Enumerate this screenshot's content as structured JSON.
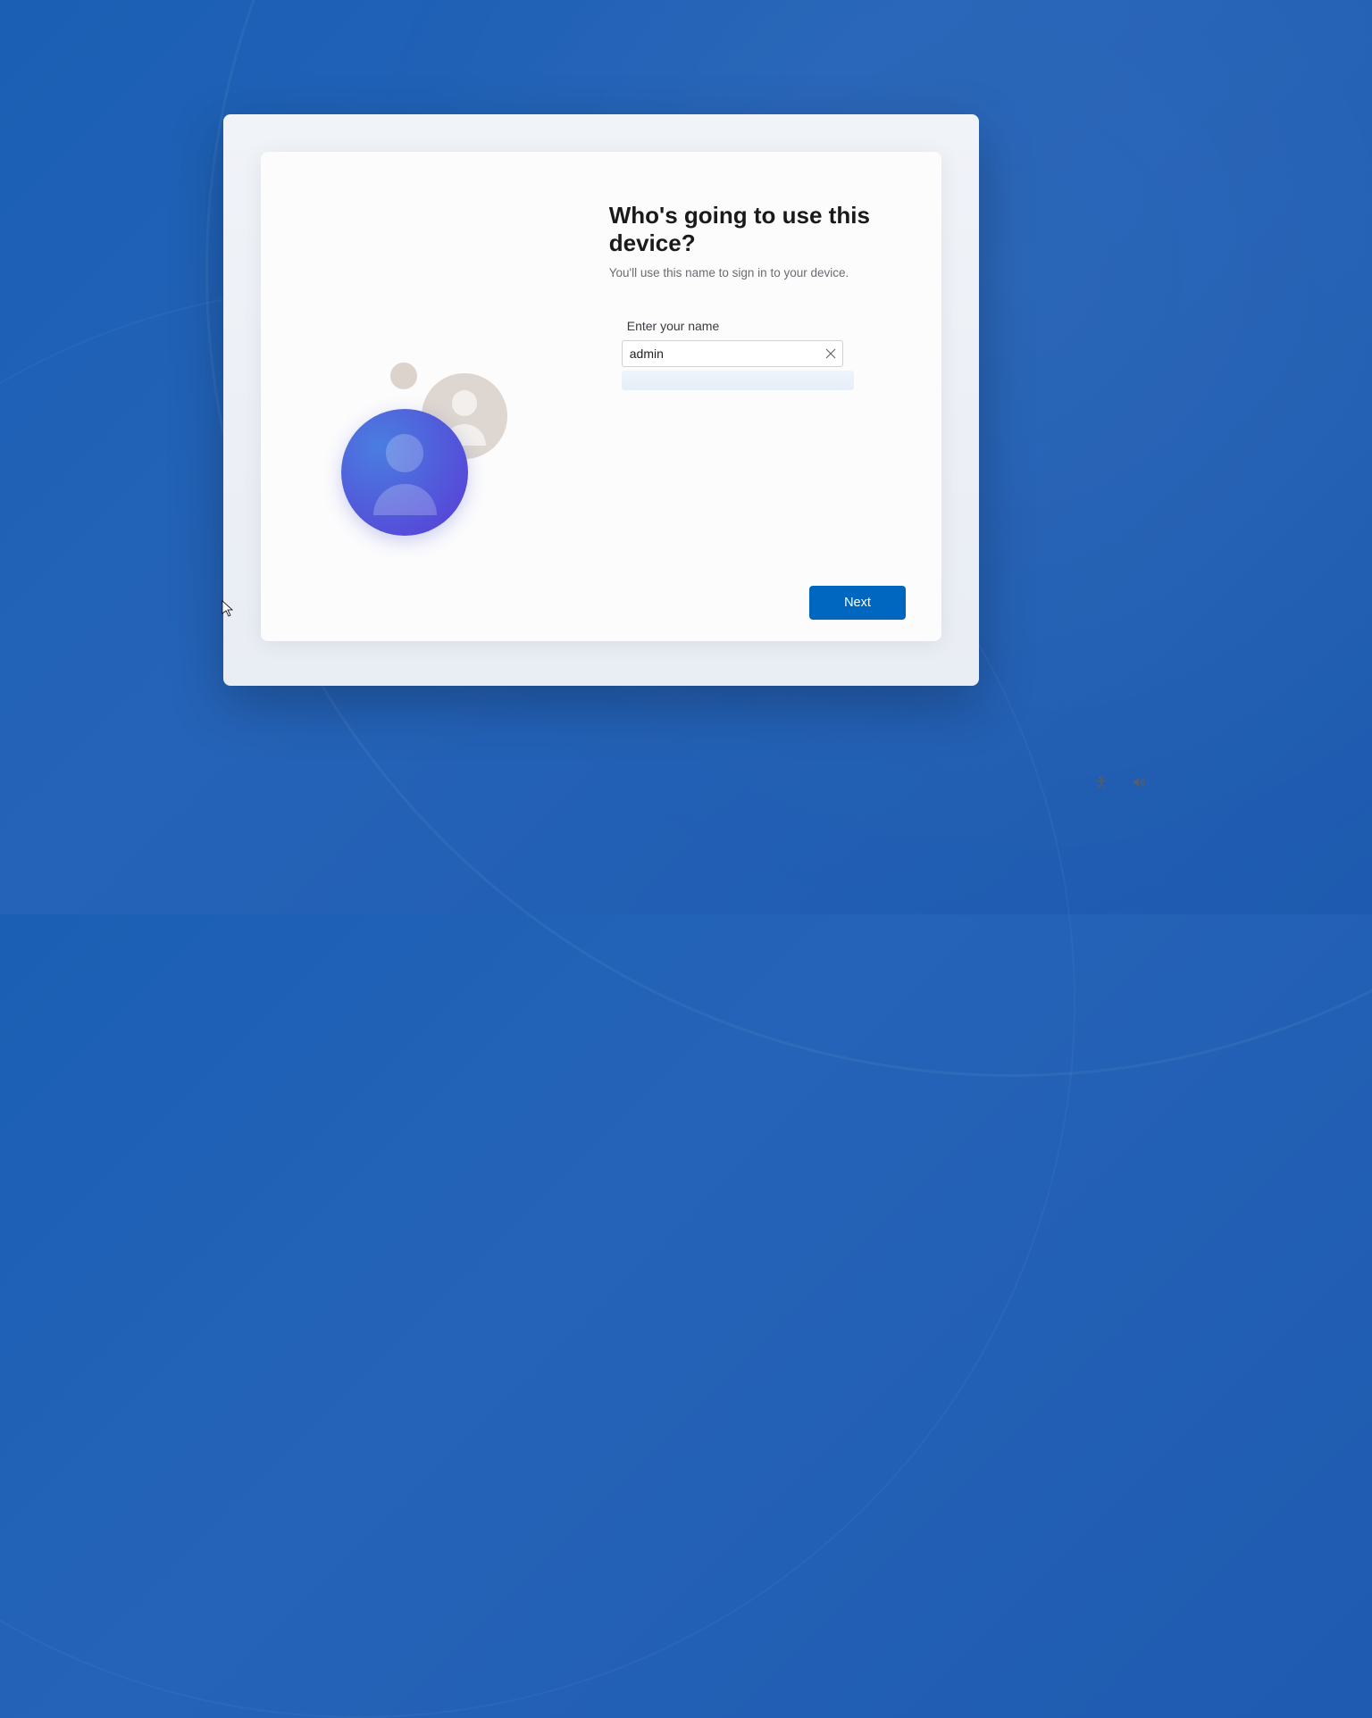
{
  "setup": {
    "title": "Who's going to use this device?",
    "subtitle": "You'll use this name to sign in to your device.",
    "field_label": "Enter your name",
    "name_value": "admin",
    "next_label": "Next"
  }
}
